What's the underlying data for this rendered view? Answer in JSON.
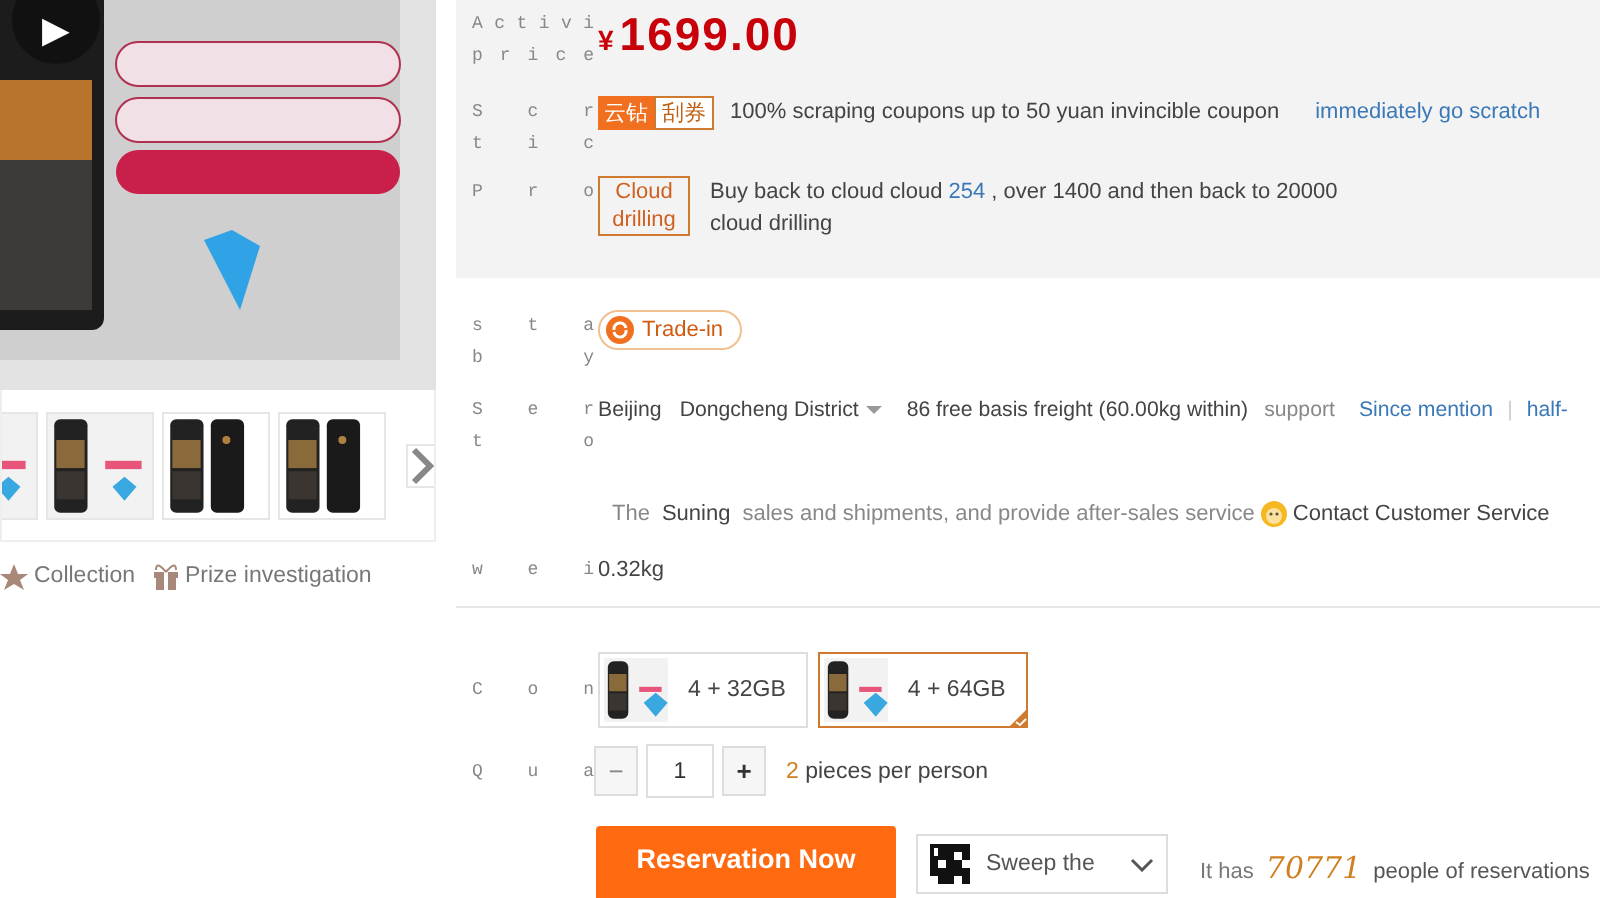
{
  "gallery": {
    "play_button": {
      "symbol": "▶"
    },
    "actions": [
      {
        "kind": "star",
        "label": "Collection"
      },
      {
        "kind": "gift",
        "label": "Prize investigation"
      }
    ]
  },
  "price": {
    "label": [
      "A c t i v i",
      "p r i c e"
    ],
    "currency": "¥",
    "amount": "1699.00"
  },
  "scratch": {
    "label": [
      "S c r",
      "t i c"
    ],
    "badges": [
      "云钻",
      "刮券"
    ],
    "text": "100% scraping coupons up to 50 yuan invincible coupon",
    "link": "immediately go scratch"
  },
  "promo": {
    "label": [
      "P r o"
    ],
    "tag": "Cloud drilling",
    "text_before": "Buy back to cloud cloud ",
    "highlight": "254",
    "text_after": " , over 1400 and then back to 20000 cloud drilling"
  },
  "trade": {
    "label": [
      "s t a",
      "b y"
    ],
    "badge": "Trade-in"
  },
  "service": {
    "label": [
      "S e r",
      "t o"
    ],
    "city": "Beijing",
    "district": "Dongcheng District",
    "freight": "86 free basis freight (60.00kg within)",
    "support": "support",
    "links": [
      "Since mention",
      "half-"
    ],
    "separator": "|",
    "seller_prefix": "The",
    "seller": "Suning",
    "seller_text": "sales and shipments, and provide after-sales service",
    "contact": "Contact Customer Service"
  },
  "weight": {
    "label": [
      "w e i"
    ],
    "value": "0.32kg"
  },
  "config": {
    "label": [
      "C o n"
    ],
    "options": [
      {
        "label": "4 + 32GB",
        "selected": false
      },
      {
        "label": "4 + 64GB",
        "selected": true
      }
    ]
  },
  "quantity": {
    "label": [
      "Q u a"
    ],
    "minus": "−",
    "minus_disabled": true,
    "value": "1",
    "plus": "+",
    "limit": "2",
    "limit_text": " pieces per person"
  },
  "actions": {
    "reserve": "Reservation Now",
    "sweep": "Sweep the",
    "count_prefix": "It has",
    "count": "70771",
    "count_suffix": "people of reservations"
  }
}
